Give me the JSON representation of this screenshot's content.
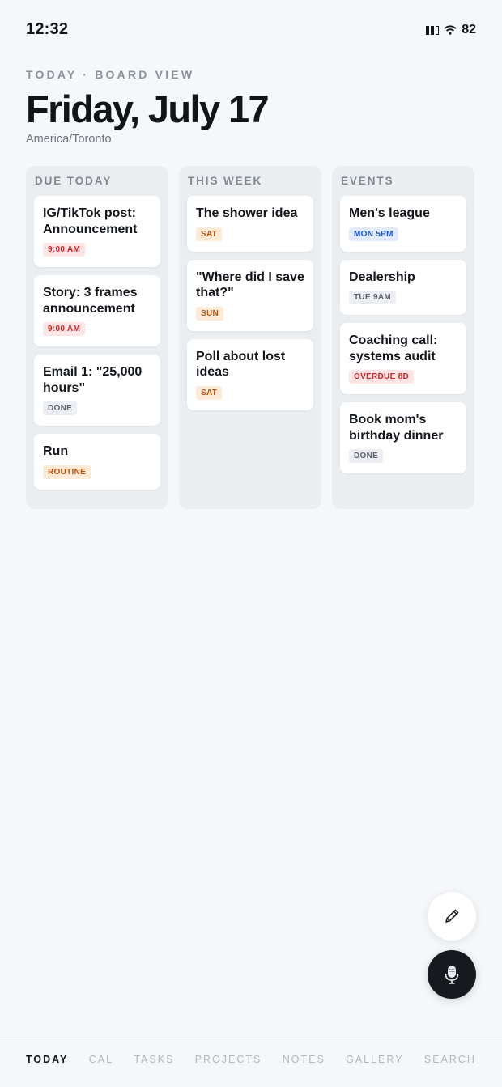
{
  "status": {
    "time": "12:32",
    "battery": "82",
    "icons": [
      "signal-icon",
      "wifi-icon"
    ]
  },
  "header": {
    "eyebrow": "TODAY · BOARD VIEW",
    "title": "Friday, July 17",
    "timezone": "America/Toronto"
  },
  "columns": [
    {
      "title": "DUE TODAY",
      "cards": [
        {
          "title": "IG/TikTok post: Announcement",
          "badge": "9:00 AM",
          "badge_color": "red"
        },
        {
          "title": "Story: 3 frames announcement",
          "badge": "9:00 AM",
          "badge_color": "red"
        },
        {
          "title": "Email 1: \"25,000 hours\"",
          "badge": "DONE",
          "badge_color": "gray"
        },
        {
          "title": "Run",
          "badge": "ROUTINE",
          "badge_color": "orange"
        }
      ]
    },
    {
      "title": "THIS WEEK",
      "cards": [
        {
          "title": "The shower idea",
          "badge": "SAT",
          "badge_color": "orange"
        },
        {
          "title": "\"Where did I save that?\"",
          "badge": "SUN",
          "badge_color": "orange"
        },
        {
          "title": "Poll about lost ideas",
          "badge": "SAT",
          "badge_color": "orange"
        }
      ]
    },
    {
      "title": "EVENTS",
      "cards": [
        {
          "title": "Men's league",
          "badge": "MON 5PM",
          "badge_color": "blue"
        },
        {
          "title": "Dealership",
          "badge": "TUE 9AM",
          "badge_color": "gray"
        },
        {
          "title": "Coaching call: systems audit",
          "badge": "OVERDUE 8D",
          "badge_color": "red"
        },
        {
          "title": "Book mom's birthday dinner",
          "badge": "DONE",
          "badge_color": "gray"
        }
      ]
    }
  ],
  "fabs": {
    "edit_icon": "pencil-icon",
    "mic_icon": "microphone-icon"
  },
  "tabs": [
    {
      "label": "TODAY",
      "active": true
    },
    {
      "label": "CAL",
      "active": false
    },
    {
      "label": "TASKS",
      "active": false
    },
    {
      "label": "PROJECTS",
      "active": false
    },
    {
      "label": "NOTES",
      "active": false
    },
    {
      "label": "GALLERY",
      "active": false
    },
    {
      "label": "SEARCH",
      "active": false
    }
  ],
  "colors": {
    "background": "#f5f7f9",
    "column": "#ebeef1",
    "text": "#111418",
    "muted": "#8a929c",
    "badge_red": "#c62626",
    "badge_orange": "#b8520e",
    "badge_blue": "#2458c6",
    "badge_gray": "#5d6570"
  }
}
